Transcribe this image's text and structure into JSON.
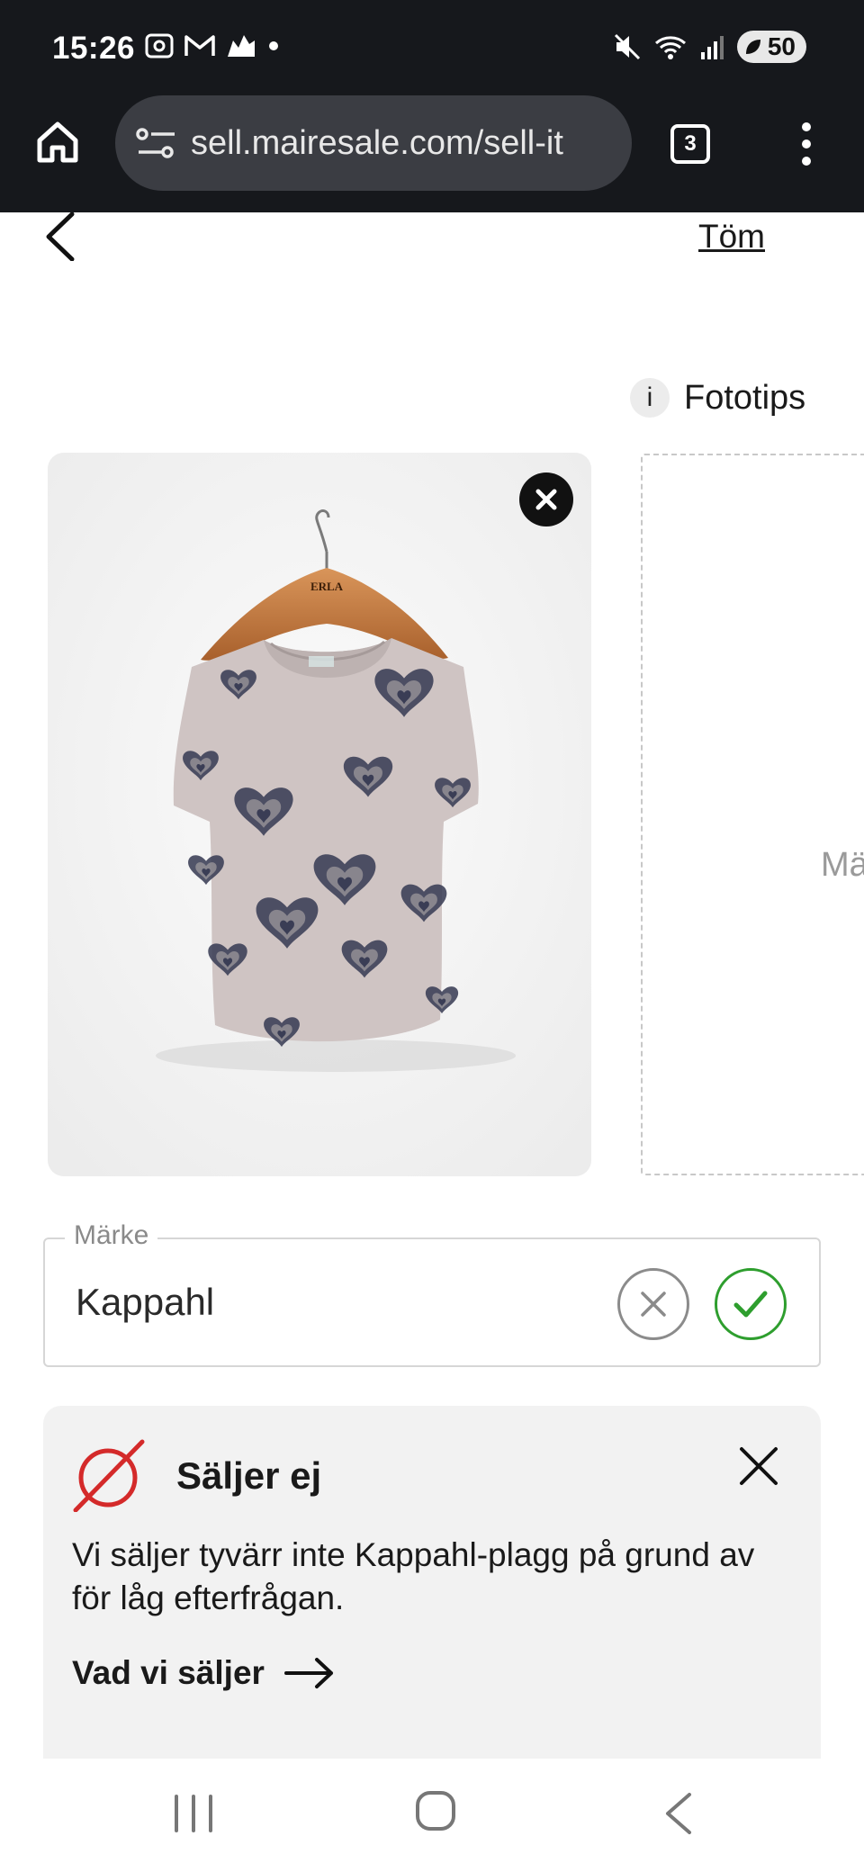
{
  "status_bar": {
    "time": "15:26",
    "battery": "50"
  },
  "browser": {
    "url": "sell.mairesale.com/sell-it",
    "tab_count": "3"
  },
  "header": {
    "clear_label": "Töm"
  },
  "photos": {
    "tips_label": "Fototips",
    "info_glyph": "i",
    "upload_hint": "Mä",
    "hanger_brand": "ERLA"
  },
  "brand_field": {
    "label": "Märke",
    "value": "Kappahl"
  },
  "notice": {
    "title": "Säljer ej",
    "body": "Vi säljer tyvärr inte Kappahl-plagg på grund av för låg efterfrågan.",
    "link_label": "Vad vi säljer"
  },
  "colors": {
    "chrome_bg": "#16181c",
    "accept_green": "#2e9e2e",
    "notice_red": "#d42a2a",
    "notice_bg": "#f2f2f2"
  }
}
